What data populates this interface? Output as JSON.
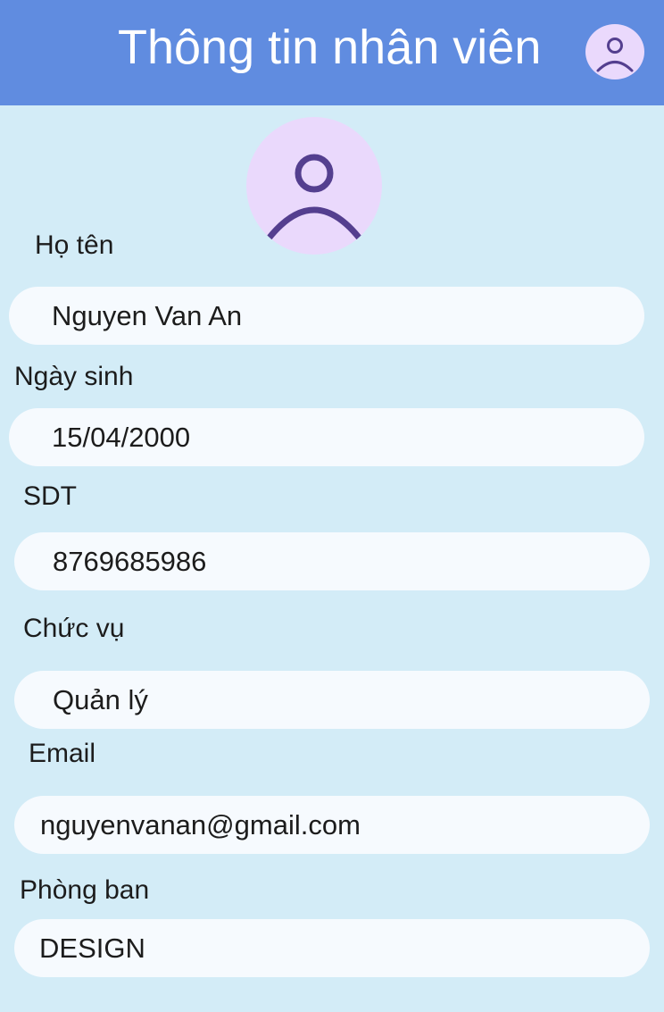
{
  "header": {
    "title": "Thông tin nhân viên",
    "avatar_icon": "user-avatar-icon",
    "background": "#608ce0"
  },
  "profile": {
    "avatar_icon": "user-avatar-icon",
    "avatar_background": "#ead9fc",
    "icon_color": "#543f8f"
  },
  "form": {
    "name_label": "Họ tên",
    "name_value": "Nguyen Van An",
    "dob_label": "Ngày sinh",
    "dob_value": "15/04/2000",
    "phone_label": "SDT",
    "phone_value": "8769685986",
    "position_label": "Chức vụ",
    "position_value": "Quản lý",
    "email_label": "Email",
    "email_value": "nguyenvanan@gmail.com",
    "department_label": "Phòng ban",
    "department_value": "DESIGN"
  },
  "colors": {
    "page_background": "#d3ecf7",
    "field_background": "#f6fafe"
  }
}
